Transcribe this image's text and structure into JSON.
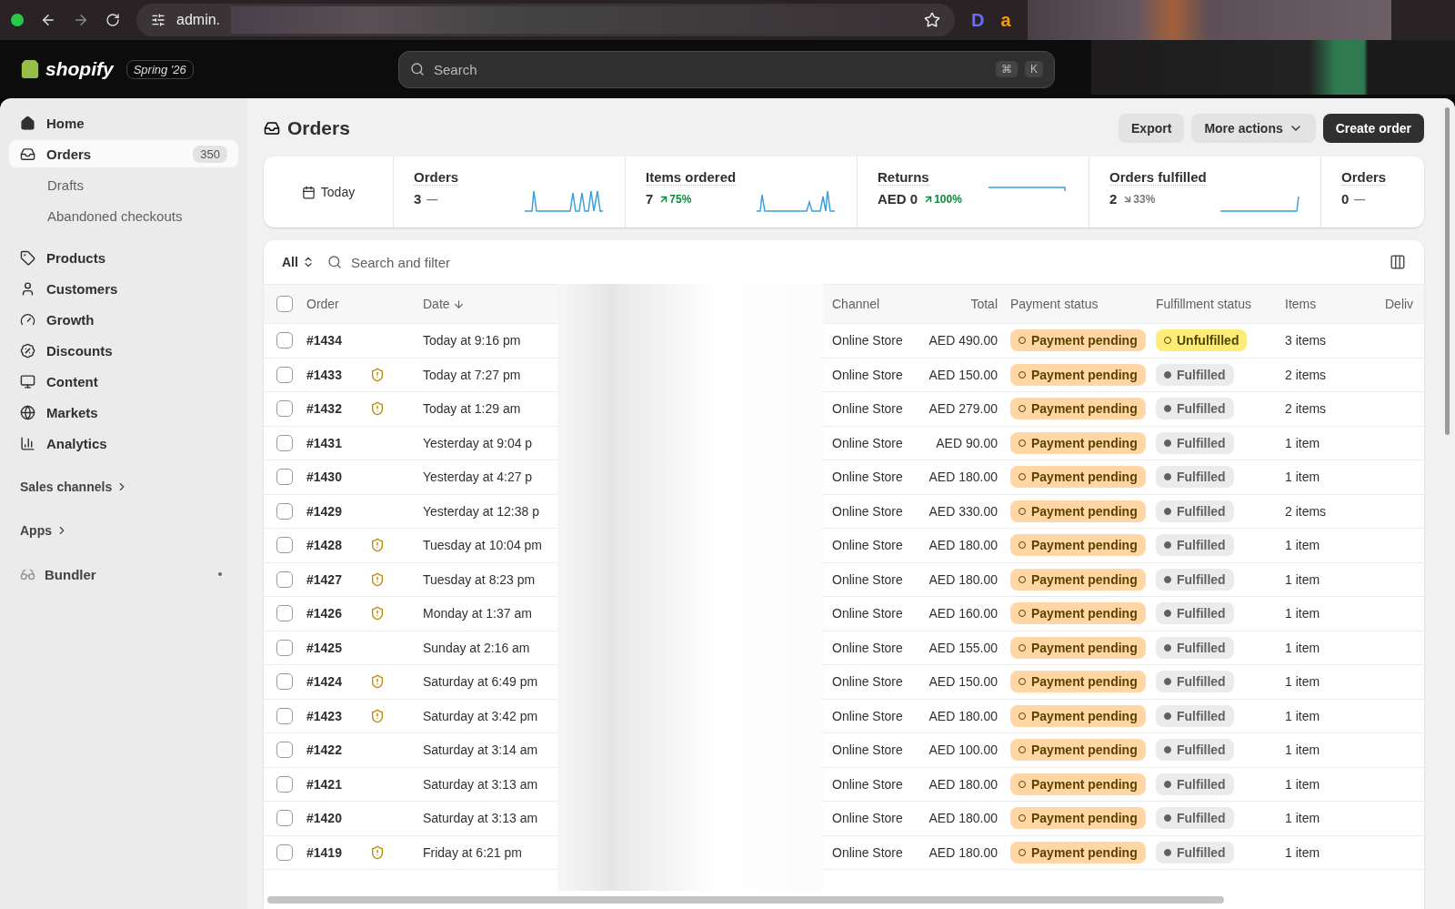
{
  "browser": {
    "url": "admin.",
    "extensions": [
      {
        "label": "D",
        "color": "#6b6cf6"
      },
      {
        "label": "a",
        "color": "#ff9900"
      }
    ]
  },
  "header": {
    "brand": "shopify",
    "edition": "Spring '26",
    "search": {
      "placeholder": "Search",
      "keys": [
        "⌘",
        "K"
      ]
    }
  },
  "sidebar": {
    "items": [
      {
        "label": "Home",
        "selected": false
      },
      {
        "label": "Orders",
        "selected": true,
        "count": "350",
        "children": [
          {
            "label": "Drafts"
          },
          {
            "label": "Abandoned checkouts"
          }
        ]
      },
      {
        "label": "Products",
        "selected": false
      },
      {
        "label": "Customers",
        "selected": false
      },
      {
        "label": "Growth",
        "selected": false
      },
      {
        "label": "Discounts",
        "selected": false
      },
      {
        "label": "Content",
        "selected": false
      },
      {
        "label": "Markets",
        "selected": false
      },
      {
        "label": "Analytics",
        "selected": false
      }
    ],
    "sections": [
      {
        "label": "Sales channels"
      },
      {
        "label": "Apps"
      }
    ],
    "apps": [
      {
        "label": "Bundler"
      }
    ]
  },
  "page": {
    "title": "Orders",
    "actions": [
      {
        "label": "Export",
        "kind": "plain"
      },
      {
        "label": "More actions",
        "kind": "menu"
      },
      {
        "label": "Create order",
        "kind": "primary"
      }
    ]
  },
  "stats": {
    "period": "Today",
    "metrics": [
      {
        "label": "Orders",
        "value": "3",
        "trend": {
          "kind": "flat",
          "text": "—"
        }
      },
      {
        "label": "Items ordered",
        "value": "7",
        "trend": {
          "kind": "up",
          "text": "75%"
        }
      },
      {
        "label": "Returns",
        "value": "AED 0",
        "trend": {
          "kind": "up",
          "text": "100%"
        }
      },
      {
        "label": "Orders fulfilled",
        "value": "2",
        "trend": {
          "kind": "down",
          "text": "33%"
        }
      },
      {
        "label": "Orders",
        "value": "0",
        "trend": {
          "kind": "flat",
          "text": "—"
        }
      }
    ]
  },
  "filter": {
    "view": "All",
    "placeholder": "Search and filter"
  },
  "table": {
    "all_checked": false,
    "columns": [
      "Order",
      "Date",
      "Channel",
      "Total",
      "Payment status",
      "Fulfillment status",
      "Items",
      "Deliv"
    ],
    "rows": [
      {
        "order": "#1434",
        "checked": false,
        "alert": false,
        "date": "Today at 9:16 pm",
        "channel": "Online Store",
        "total": "AED 490.00",
        "payment": {
          "label": "Payment pending",
          "kind": "pending"
        },
        "fulfillment": {
          "label": "Unfulfilled",
          "kind": "unfulfilled"
        },
        "items": "3 items"
      },
      {
        "order": "#1433",
        "checked": false,
        "alert": true,
        "date": "Today at 7:27 pm",
        "channel": "Online Store",
        "total": "AED 150.00",
        "payment": {
          "label": "Payment pending",
          "kind": "pending"
        },
        "fulfillment": {
          "label": "Fulfilled",
          "kind": "fulfilled"
        },
        "items": "2 items"
      },
      {
        "order": "#1432",
        "checked": false,
        "alert": true,
        "date": "Today at 1:29 am",
        "channel": "Online Store",
        "total": "AED 279.00",
        "payment": {
          "label": "Payment pending",
          "kind": "pending"
        },
        "fulfillment": {
          "label": "Fulfilled",
          "kind": "fulfilled"
        },
        "items": "2 items"
      },
      {
        "order": "#1431",
        "checked": false,
        "alert": false,
        "date": "Yesterday at 9:04 p",
        "channel": "Online Store",
        "total": "AED 90.00",
        "payment": {
          "label": "Payment pending",
          "kind": "pending"
        },
        "fulfillment": {
          "label": "Fulfilled",
          "kind": "fulfilled"
        },
        "items": "1 item"
      },
      {
        "order": "#1430",
        "checked": false,
        "alert": false,
        "date": "Yesterday at 4:27 p",
        "channel": "Online Store",
        "total": "AED 180.00",
        "payment": {
          "label": "Payment pending",
          "kind": "pending"
        },
        "fulfillment": {
          "label": "Fulfilled",
          "kind": "fulfilled"
        },
        "items": "1 item"
      },
      {
        "order": "#1429",
        "checked": false,
        "alert": false,
        "date": "Yesterday at 12:38 p",
        "channel": "Online Store",
        "total": "AED 330.00",
        "payment": {
          "label": "Payment pending",
          "kind": "pending"
        },
        "fulfillment": {
          "label": "Fulfilled",
          "kind": "fulfilled"
        },
        "items": "2 items"
      },
      {
        "order": "#1428",
        "checked": false,
        "alert": true,
        "date": "Tuesday at 10:04 pm",
        "channel": "Online Store",
        "total": "AED 180.00",
        "payment": {
          "label": "Payment pending",
          "kind": "pending"
        },
        "fulfillment": {
          "label": "Fulfilled",
          "kind": "fulfilled"
        },
        "items": "1 item"
      },
      {
        "order": "#1427",
        "checked": false,
        "alert": true,
        "date": "Tuesday at 8:23 pm",
        "channel": "Online Store",
        "total": "AED 180.00",
        "payment": {
          "label": "Payment pending",
          "kind": "pending"
        },
        "fulfillment": {
          "label": "Fulfilled",
          "kind": "fulfilled"
        },
        "items": "1 item"
      },
      {
        "order": "#1426",
        "checked": false,
        "alert": true,
        "date": "Monday at 1:37 am",
        "channel": "Online Store",
        "total": "AED 160.00",
        "payment": {
          "label": "Payment pending",
          "kind": "pending"
        },
        "fulfillment": {
          "label": "Fulfilled",
          "kind": "fulfilled"
        },
        "items": "1 item"
      },
      {
        "order": "#1425",
        "checked": false,
        "alert": false,
        "date": "Sunday at 2:16 am",
        "channel": "Online Store",
        "total": "AED 155.00",
        "payment": {
          "label": "Payment pending",
          "kind": "pending"
        },
        "fulfillment": {
          "label": "Fulfilled",
          "kind": "fulfilled"
        },
        "items": "1 item"
      },
      {
        "order": "#1424",
        "checked": false,
        "alert": true,
        "date": "Saturday at 6:49 pm",
        "channel": "Online Store",
        "total": "AED 150.00",
        "payment": {
          "label": "Payment pending",
          "kind": "pending"
        },
        "fulfillment": {
          "label": "Fulfilled",
          "kind": "fulfilled"
        },
        "items": "1 item"
      },
      {
        "order": "#1423",
        "checked": false,
        "alert": true,
        "date": "Saturday at 3:42 pm",
        "channel": "Online Store",
        "total": "AED 180.00",
        "payment": {
          "label": "Payment pending",
          "kind": "pending"
        },
        "fulfillment": {
          "label": "Fulfilled",
          "kind": "fulfilled"
        },
        "items": "1 item"
      },
      {
        "order": "#1422",
        "checked": false,
        "alert": false,
        "date": "Saturday at 3:14 am",
        "channel": "Online Store",
        "total": "AED 100.00",
        "payment": {
          "label": "Payment pending",
          "kind": "pending"
        },
        "fulfillment": {
          "label": "Fulfilled",
          "kind": "fulfilled"
        },
        "items": "1 item"
      },
      {
        "order": "#1421",
        "checked": false,
        "alert": false,
        "date": "Saturday at 3:13 am",
        "channel": "Online Store",
        "total": "AED 180.00",
        "payment": {
          "label": "Payment pending",
          "kind": "pending"
        },
        "fulfillment": {
          "label": "Fulfilled",
          "kind": "fulfilled"
        },
        "items": "1 item"
      },
      {
        "order": "#1420",
        "checked": false,
        "alert": false,
        "date": "Saturday at 3:13 am",
        "channel": "Online Store",
        "total": "AED 180.00",
        "payment": {
          "label": "Payment pending",
          "kind": "pending"
        },
        "fulfillment": {
          "label": "Fulfilled",
          "kind": "fulfilled"
        },
        "items": "1 item"
      },
      {
        "order": "#1419",
        "checked": false,
        "alert": true,
        "date": "Friday at 6:21 pm",
        "channel": "Online Store",
        "total": "AED 180.00",
        "payment": {
          "label": "Payment pending",
          "kind": "pending"
        },
        "fulfillment": {
          "label": "Fulfilled",
          "kind": "fulfilled"
        },
        "items": "1 item"
      }
    ]
  }
}
